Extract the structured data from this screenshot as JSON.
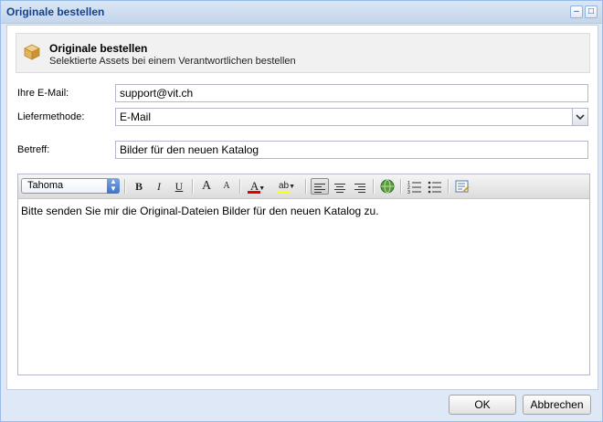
{
  "window": {
    "title": "Originale bestellen",
    "minimize_glyph": "‒",
    "maximize_glyph": "□"
  },
  "header": {
    "icon": "package-icon",
    "title": "Originale bestellen",
    "subtitle": "Selektierte Assets bei einem Verantwortlichen bestellen"
  },
  "form": {
    "email_label": "Ihre E-Mail:",
    "email_value": "support@vit.ch",
    "delivery_label": "Liefermethode:",
    "delivery_value": "E-Mail",
    "subject_label": "Betreff:",
    "subject_value": "Bilder für den neuen Katalog"
  },
  "editor": {
    "font": "Tahoma",
    "toolbar": {
      "bold": "B",
      "italic": "I",
      "underline": "U",
      "grow": "A",
      "shrink": "A",
      "font_color": "A",
      "highlight": "ab"
    },
    "body": "Bitte senden Sie mir die Original-Dateien Bilder für den neuen Katalog zu."
  },
  "buttons": {
    "ok": "OK",
    "cancel": "Abbrechen"
  },
  "colors": {
    "accent": "#15428b",
    "font_color_swatch": "#e00000",
    "highlight_swatch": "#ffff00"
  }
}
